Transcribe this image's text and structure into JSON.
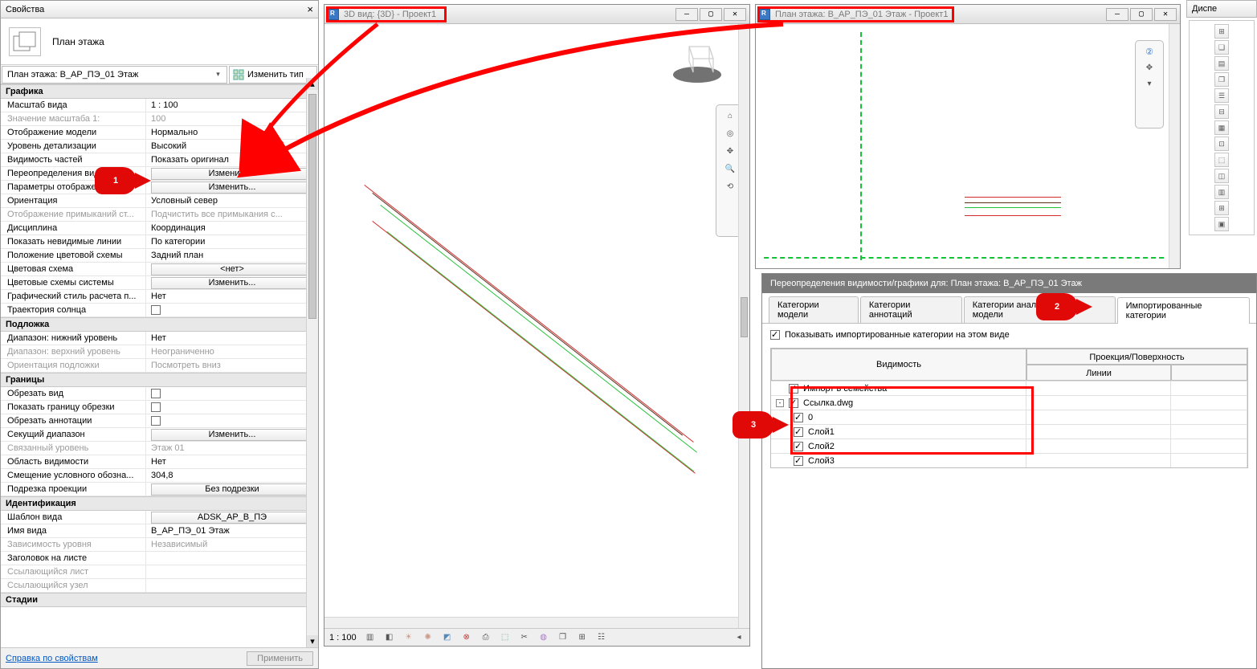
{
  "properties_panel": {
    "title": "Свойства",
    "header_label": "План этажа",
    "type_selector": "План этажа: В_АР_ПЭ_01 Этаж",
    "edit_type_label": "Изменить тип",
    "apply_button": "Применить",
    "help_link": "Справка по свойствам",
    "groups": [
      {
        "title": "Графика",
        "rows": [
          {
            "label": "Масштаб вида",
            "value": "1 : 100",
            "type": "text"
          },
          {
            "label": "Значение масштаба    1:",
            "value": "100",
            "type": "text",
            "disabled": true
          },
          {
            "label": "Отображение модели",
            "value": "Нормально",
            "type": "text"
          },
          {
            "label": "Уровень детализации",
            "value": "Высокий",
            "type": "text"
          },
          {
            "label": "Видимость частей",
            "value": "Показать оригинал",
            "type": "text"
          },
          {
            "label": "Переопределения видим...",
            "value": "Изменить...",
            "type": "button"
          },
          {
            "label": "Параметры отображения гра...",
            "value": "Изменить...",
            "type": "button"
          },
          {
            "label": "Ориентация",
            "value": "Условный север",
            "type": "text"
          },
          {
            "label": "Отображение примыканий ст...",
            "value": "Подчистить все примыкания с...",
            "type": "text",
            "disabled": true
          },
          {
            "label": "Дисциплина",
            "value": "Координация",
            "type": "text"
          },
          {
            "label": "Показать невидимые линии",
            "value": "По категории",
            "type": "text"
          },
          {
            "label": "Положение цветовой схемы",
            "value": "Задний план",
            "type": "text"
          },
          {
            "label": "Цветовая схема",
            "value": "<нет>",
            "type": "button"
          },
          {
            "label": "Цветовые схемы системы",
            "value": "Изменить...",
            "type": "button"
          },
          {
            "label": "Графический стиль расчета п...",
            "value": "Нет",
            "type": "text"
          },
          {
            "label": "Траектория солнца",
            "value": "",
            "type": "check",
            "checked": false
          }
        ]
      },
      {
        "title": "Подложка",
        "rows": [
          {
            "label": "Диапазон: нижний уровень",
            "value": "Нет",
            "type": "text"
          },
          {
            "label": "Диапазон: верхний уровень",
            "value": "Неограниченно",
            "type": "text",
            "disabled": true
          },
          {
            "label": "Ориентация подложки",
            "value": "Посмотреть вниз",
            "type": "text",
            "disabled": true
          }
        ]
      },
      {
        "title": "Границы",
        "rows": [
          {
            "label": "Обрезать вид",
            "value": "",
            "type": "check",
            "checked": false
          },
          {
            "label": "Показать границу обрезки",
            "value": "",
            "type": "check",
            "checked": false
          },
          {
            "label": "Обрезать аннотации",
            "value": "",
            "type": "check",
            "checked": false
          },
          {
            "label": "Секущий диапазон",
            "value": "Изменить...",
            "type": "button"
          },
          {
            "label": "Связанный уровень",
            "value": "Этаж 01",
            "type": "text",
            "disabled": true
          },
          {
            "label": "Область видимости",
            "value": "Нет",
            "type": "text"
          },
          {
            "label": "Смещение условного обозна...",
            "value": "304,8",
            "type": "text"
          },
          {
            "label": "Подрезка проекции",
            "value": "Без подрезки",
            "type": "button"
          }
        ]
      },
      {
        "title": "Идентификация",
        "rows": [
          {
            "label": "Шаблон вида",
            "value": "ADSK_АР_В_ПЭ",
            "type": "button"
          },
          {
            "label": "Имя вида",
            "value": "В_АР_ПЭ_01 Этаж",
            "type": "text"
          },
          {
            "label": "Зависимость уровня",
            "value": "Независимый",
            "type": "text",
            "disabled": true
          },
          {
            "label": "Заголовок на листе",
            "value": "",
            "type": "text"
          },
          {
            "label": "Ссылающийся лист",
            "value": "",
            "type": "text",
            "disabled": true
          },
          {
            "label": "Ссылающийся узел",
            "value": "",
            "type": "text",
            "disabled": true
          }
        ]
      },
      {
        "title": "Стадии",
        "rows": []
      }
    ]
  },
  "view3d": {
    "title": "3D вид: {3D} - Проект1",
    "status_scale": "1 : 100"
  },
  "viewplan": {
    "title": "План этажа: В_АР_ПЭ_01 Этаж - Проект1"
  },
  "vg_dialog": {
    "title": "Переопределения видимости/графики для: План этажа: В_АР_ПЭ_01 Этаж",
    "tabs": [
      "Категории модели",
      "Категории аннотаций",
      "Категории аналитической модели",
      "Импортированные категории"
    ],
    "active_tab": 3,
    "show_check_label": "Показывать импортированные категории на этом виде",
    "col_vis": "Видимость",
    "col_proj": "Проекция/Поверхность",
    "col_lines": "Линии",
    "rows": [
      {
        "label": "Импорт в семейства",
        "checked": true,
        "indent": 0
      },
      {
        "label": "Ссылка.dwg",
        "checked": true,
        "indent": 0,
        "exp": "-"
      },
      {
        "label": "0",
        "checked": true,
        "indent": 1
      },
      {
        "label": "Слой1",
        "checked": true,
        "indent": 1
      },
      {
        "label": "Слой2",
        "checked": true,
        "indent": 1
      },
      {
        "label": "Слой3",
        "checked": true,
        "indent": 1
      }
    ]
  },
  "right_strip": {
    "title": "Диспе"
  },
  "annotations": {
    "n1": "1",
    "n2": "2",
    "n3": "3"
  }
}
